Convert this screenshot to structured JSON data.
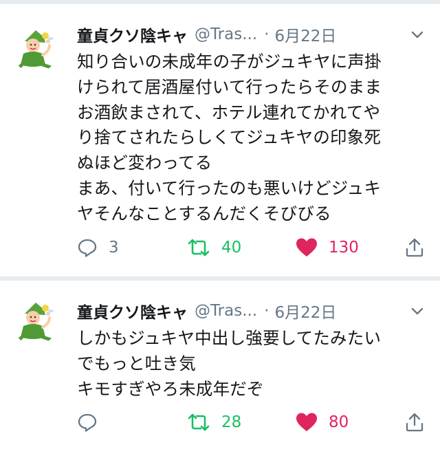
{
  "tweets": [
    {
      "name": "童貞クソ陰キャ",
      "handle": "@Tras...",
      "separator": "·",
      "date": "6月22日",
      "lines": [
        "知り合いの未成年の子がジュキヤに声掛",
        "けられて居酒屋付いて行ったらそのまま",
        "お酒飲まされて、ホテル連れてかれてや",
        "り捨てされたらしくてジュキヤの印象死",
        "ぬほど変わってる",
        "まあ、付いて行ったのも悪いけどジュキ",
        "ヤそんなことするんだくそびびる"
      ],
      "replies": "3",
      "retweets": "40",
      "likes": "130"
    },
    {
      "name": "童貞クソ陰キャ",
      "handle": "@Tras...",
      "separator": "·",
      "date": "6月22日",
      "lines": [
        "しかもジュキヤ中出し強要してたみたい",
        "でもっと吐き気",
        "キモすぎやろ未成年だぞ"
      ],
      "replies": "",
      "retweets": "28",
      "likes": "80"
    }
  ],
  "icons": {
    "reply": "reply-icon",
    "retweet": "retweet-icon",
    "like": "heart-icon",
    "share": "share-icon",
    "caret": "chevron-down-icon",
    "avatar": "elf-character-avatar"
  },
  "colors": {
    "text": "#14171a",
    "secondary": "#657786",
    "retweet_green": "#17bf63",
    "like_red": "#e0245e",
    "divider": "#e6ecf0"
  }
}
